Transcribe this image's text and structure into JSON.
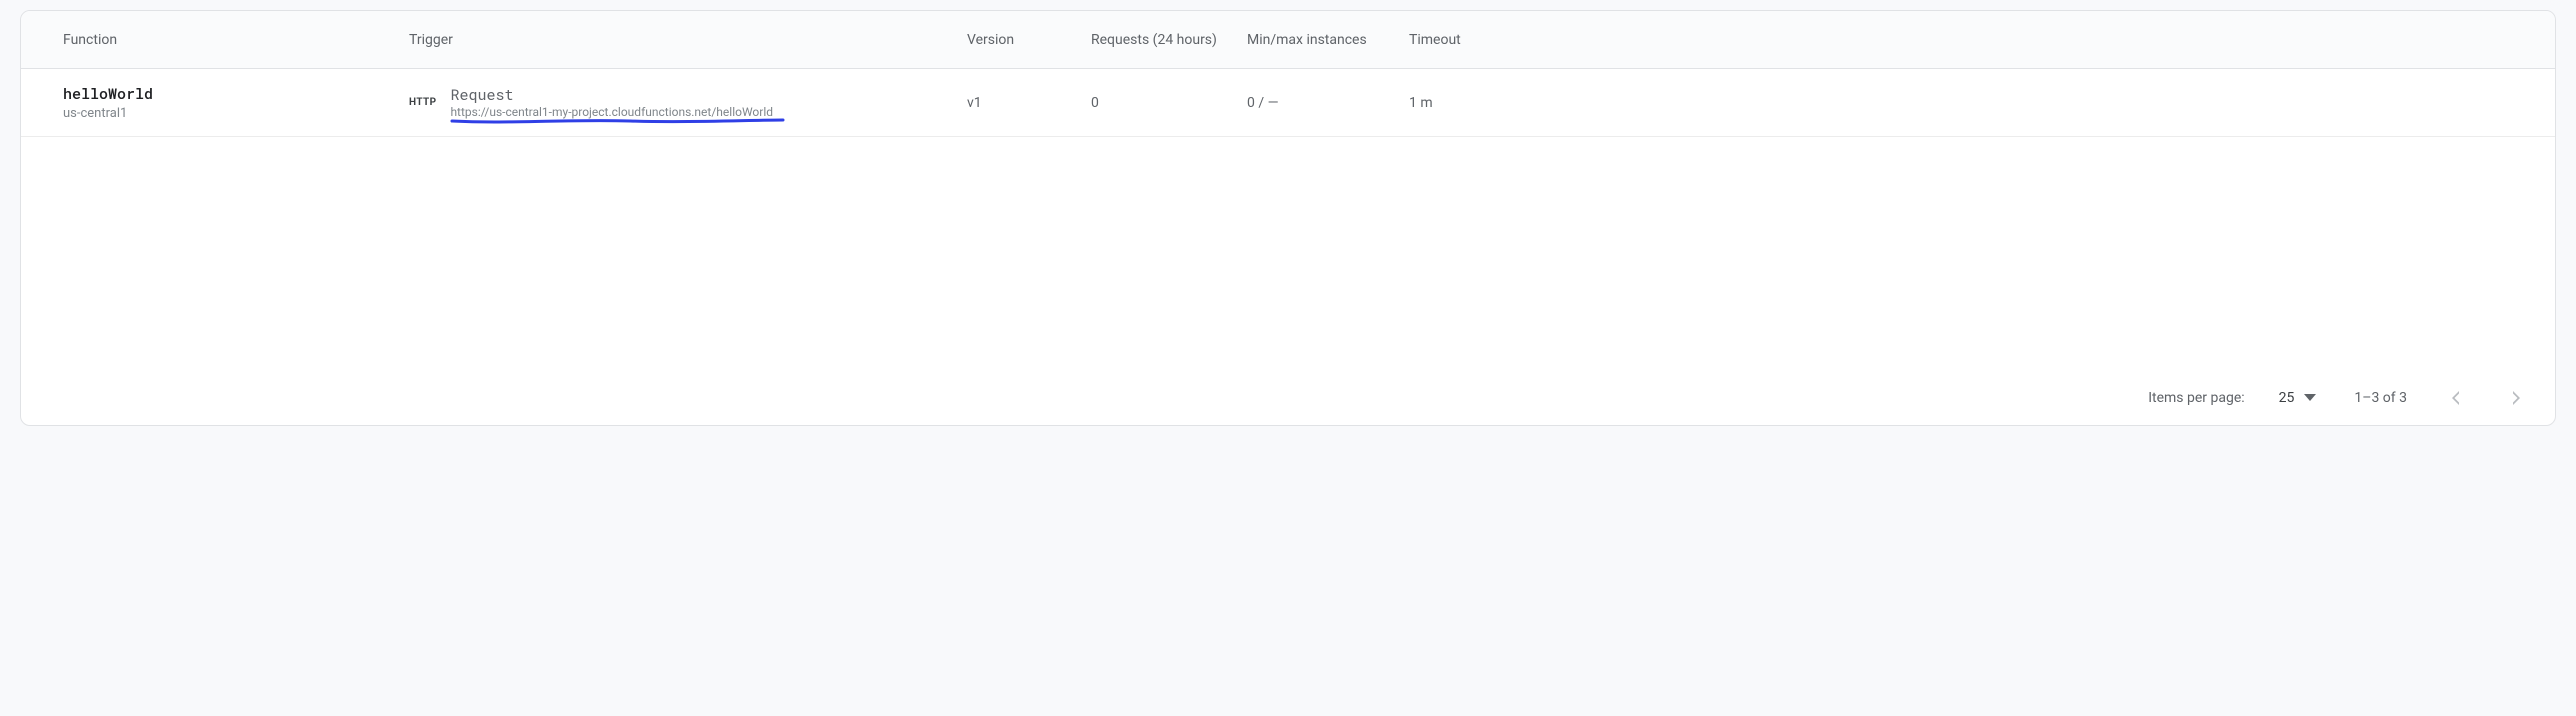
{
  "headers": {
    "function": "Function",
    "trigger": "Trigger",
    "version": "Version",
    "requests": "Requests (24 hours)",
    "minmax": "Min/max instances",
    "timeout": "Timeout"
  },
  "rows": [
    {
      "name": "helloWorld",
      "region": "us-central1",
      "trigger_badge": "HTTP",
      "trigger_label": "Request",
      "trigger_url": "https://us-central1-my-project.cloudfunctions.net/helloWorld",
      "version": "v1",
      "requests": "0",
      "minmax": "0 / —",
      "timeout": "1 m"
    }
  ],
  "paginator": {
    "items_per_page_label": "Items per page:",
    "page_size": "25",
    "range_label": "1–3 of 3"
  }
}
